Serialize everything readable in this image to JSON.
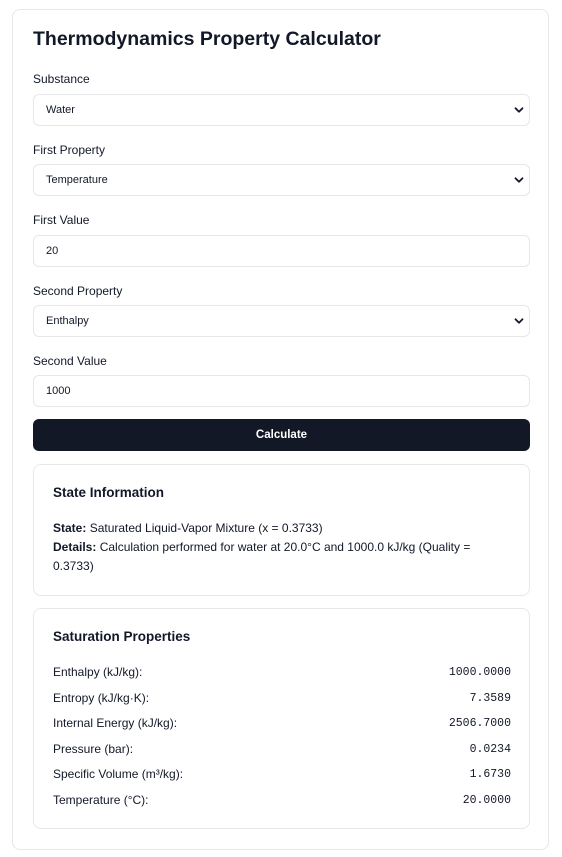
{
  "title": "Thermodynamics Property Calculator",
  "form": {
    "substance_label": "Substance",
    "substance_value": "Water",
    "first_property_label": "First Property",
    "first_property_value": "Temperature",
    "first_value_label": "First Value",
    "first_value": "20",
    "second_property_label": "Second Property",
    "second_property_value": "Enthalpy",
    "second_value_label": "Second Value",
    "second_value": "1000",
    "calculate_label": "Calculate"
  },
  "state_info": {
    "title": "State Information",
    "state_label": "State:",
    "state_value": "Saturated Liquid-Vapor Mixture (x = 0.3733)",
    "details_label": "Details:",
    "details_value": "Calculation performed for water at 20.0°C and 1000.0 kJ/kg (Quality = 0.3733)"
  },
  "saturation": {
    "title": "Saturation Properties",
    "rows": [
      {
        "label": "Enthalpy (kJ/kg):",
        "value": "1000.0000"
      },
      {
        "label": "Entropy (kJ/kg·K):",
        "value": "7.3589"
      },
      {
        "label": "Internal Energy (kJ/kg):",
        "value": "2506.7000"
      },
      {
        "label": "Pressure (bar):",
        "value": "0.0234"
      },
      {
        "label": "Specific Volume (m³/kg):",
        "value": "1.6730"
      },
      {
        "label": "Temperature (°C):",
        "value": "20.0000"
      }
    ]
  },
  "icons": {
    "select": "chevron-down-icon"
  }
}
